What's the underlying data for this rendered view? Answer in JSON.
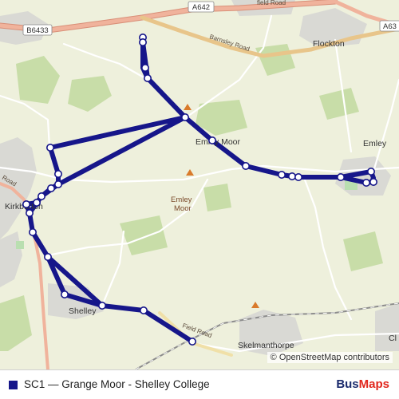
{
  "route": {
    "name": "SC1 — Grange Moor - Shelley College",
    "color": "#16168a",
    "stops": [
      {
        "id": 1
      },
      {
        "id": 2
      },
      {
        "id": 3
      },
      {
        "id": 4
      },
      {
        "id": 5
      },
      {
        "id": 6
      },
      {
        "id": 7
      },
      {
        "id": 8
      },
      {
        "id": 9
      },
      {
        "id": 10
      },
      {
        "id": 11
      },
      {
        "id": 12
      },
      {
        "id": 13
      },
      {
        "id": 14
      },
      {
        "id": 15
      },
      {
        "id": 16
      },
      {
        "id": 17
      },
      {
        "id": 18
      },
      {
        "id": 19
      },
      {
        "id": 20
      },
      {
        "id": 21
      },
      {
        "id": 22
      },
      {
        "id": 23
      },
      {
        "id": 24
      },
      {
        "id": 25
      },
      {
        "id": 26
      },
      {
        "id": 27
      },
      {
        "id": 28
      }
    ]
  },
  "map": {
    "road_labels": {
      "a642": "A642",
      "b6433": "B6433",
      "a63": "A63",
      "barnsley_road": "Barnsley Road",
      "field_road_top": "field Road",
      "field_road_bottom": "Field Road",
      "road_left": "Road"
    },
    "place_labels": {
      "flockton": "Flockton",
      "emley_moor": "Emley Moor",
      "emley": "Emley",
      "emley_moor_peak": "Emley\nMoor",
      "kirkburton": "Kirkburton",
      "shelley": "Shelley",
      "skelmanthorpe": "Skelmanthorpe",
      "cl": "Cl"
    },
    "colors": {
      "background": "#eef0dc",
      "major_road": "#e8a08a",
      "minor_road": "#ffffff",
      "urban": "#d8d8d8",
      "woodland": "#c5dca6",
      "railway": "#8c8c8c"
    }
  },
  "attribution": "© OpenStreetMap contributors",
  "brand": {
    "part1": "Bus",
    "part2": "Maps"
  }
}
